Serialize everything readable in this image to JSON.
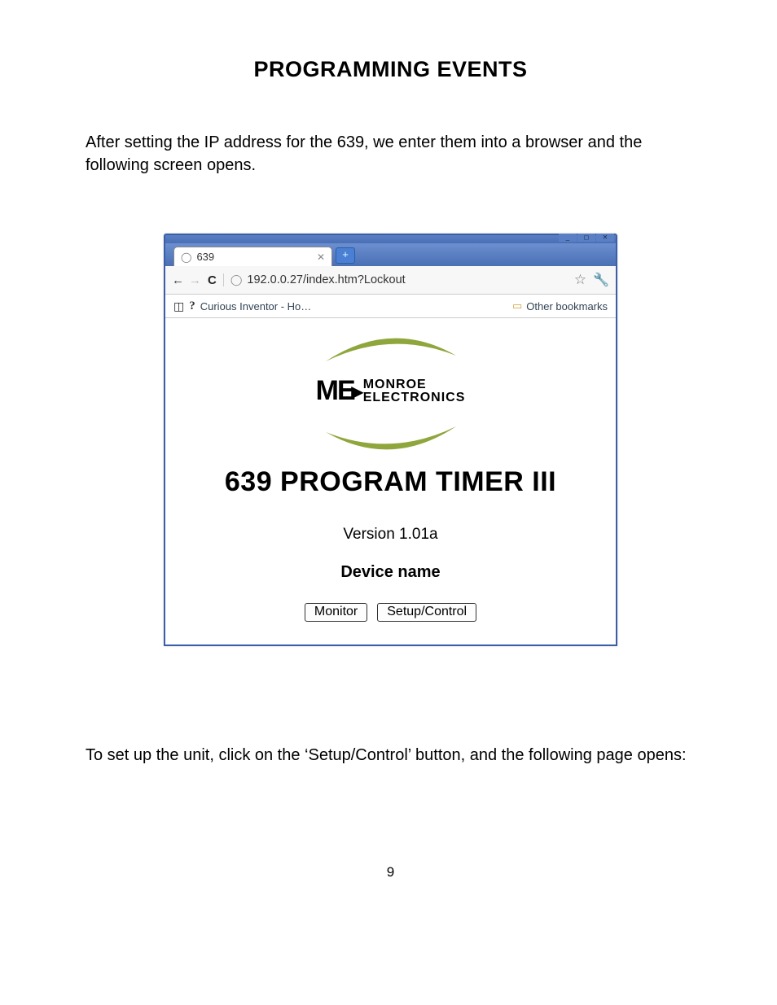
{
  "doc": {
    "heading": "PROGRAMMING EVENTS",
    "intro": "After setting the IP address for the 639, we enter them into a browser and the following screen opens.",
    "outro": "To set up the unit, click on the ‘Setup/Control’ button, and the following page opens:",
    "page_number": "9"
  },
  "browser": {
    "tab_title": "639",
    "address": "192.0.0.27/index.htm?Lockout",
    "bookmark_item": "Curious Inventor - Ho…",
    "other_bookmarks": "Other bookmarks"
  },
  "app": {
    "logo_line1": "MONROE",
    "logo_line2": "ELECTRONICS",
    "product_title": "639 PROGRAM TIMER III",
    "version_label": "Version 1.01a",
    "device_name_label": "Device name",
    "buttons": {
      "monitor": "Monitor",
      "setup": "Setup/Control"
    }
  }
}
